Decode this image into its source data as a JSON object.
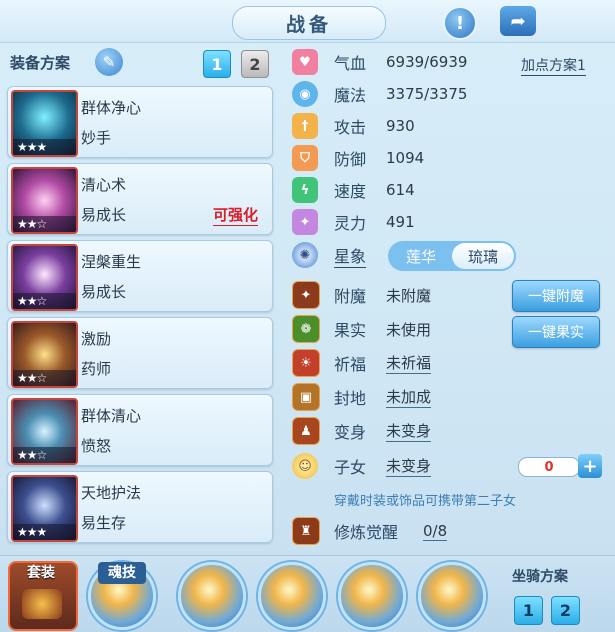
{
  "header": {
    "title": "战备",
    "alert_icon": "exclamation-icon",
    "share_icon": "share-icon"
  },
  "left": {
    "plan_title": "装备方案",
    "plan_buttons": [
      "1",
      "2"
    ],
    "skills": [
      {
        "name": "群体净心",
        "sub": "妙手",
        "stars": "★★★",
        "upgrade": ""
      },
      {
        "name": "清心术",
        "sub": "易成长",
        "stars": "★★☆",
        "upgrade": "可强化"
      },
      {
        "name": "涅槃重生",
        "sub": "易成长",
        "stars": "★★☆",
        "upgrade": ""
      },
      {
        "name": "激励",
        "sub": "药师",
        "stars": "★★☆",
        "upgrade": ""
      },
      {
        "name": "群体清心",
        "sub": "愤怒",
        "stars": "★★☆",
        "upgrade": ""
      },
      {
        "name": "天地护法",
        "sub": "易生存",
        "stars": "★★★",
        "upgrade": ""
      }
    ]
  },
  "stats": {
    "points_plan": "加点方案1",
    "rows": [
      {
        "label": "气血",
        "value": "6939/6939"
      },
      {
        "label": "魔法",
        "value": "3375/3375"
      },
      {
        "label": "攻击",
        "value": "930"
      },
      {
        "label": "防御",
        "value": "1094"
      },
      {
        "label": "速度",
        "value": "614"
      },
      {
        "label": "灵力",
        "value": "491"
      }
    ],
    "star_label": "星象",
    "star_tabs": [
      "莲华",
      "琉璃"
    ],
    "extras": [
      {
        "label": "附魔",
        "value": "未附魔"
      },
      {
        "label": "果实",
        "value": "未使用"
      },
      {
        "label": "祈福",
        "value": "未祈福"
      },
      {
        "label": "封地",
        "value": "未加成"
      },
      {
        "label": "变身",
        "value": "未变身"
      },
      {
        "label": "子女",
        "value": "未变身"
      }
    ],
    "btn_enchant": "一键附魔",
    "btn_fruit": "一键果实",
    "child_count": "0",
    "plus": "+",
    "hint": "穿戴时装或饰品可携带第二子女",
    "cultivation_label": "修炼觉醒",
    "cultivation_value": "0/8"
  },
  "bottom": {
    "suit_label": "套装",
    "soul_label": "魂技",
    "mount_title": "坐骑方案",
    "mount_buttons": [
      "1",
      "2"
    ]
  }
}
